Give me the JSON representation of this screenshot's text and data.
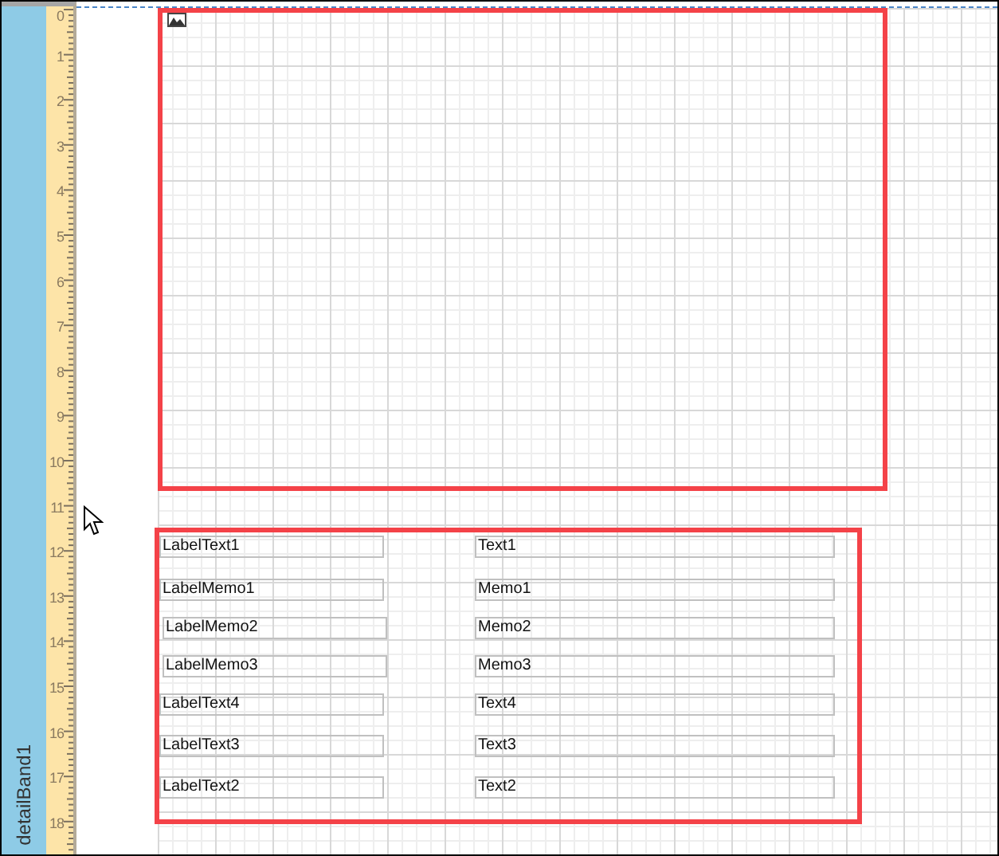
{
  "band": {
    "name": "detailBand1"
  },
  "ruler": {
    "labels": [
      "0",
      "1",
      "2",
      "3",
      "4",
      "5",
      "6",
      "7",
      "8",
      "9",
      "10",
      "11",
      "12",
      "13",
      "14",
      "15",
      "16",
      "17",
      "18"
    ]
  },
  "fields": [
    {
      "label": "LabelText1",
      "value": "Text1"
    },
    {
      "label": "LabelMemo1",
      "value": "Memo1"
    },
    {
      "label": "LabelMemo2",
      "value": "Memo2"
    },
    {
      "label": "LabelMemo3",
      "value": "Memo3"
    },
    {
      "label": "LabelText4",
      "value": "Text4"
    },
    {
      "label": "LabelText3",
      "value": "Text3"
    },
    {
      "label": "LabelText2",
      "value": "Text2"
    }
  ]
}
